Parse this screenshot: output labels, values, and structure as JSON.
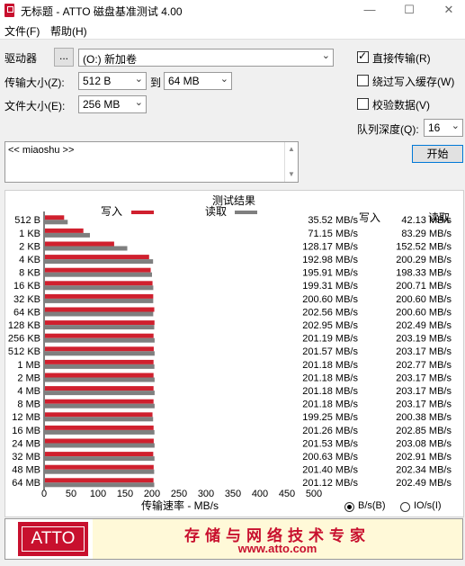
{
  "window": {
    "title": "无标题 - ATTO 磁盘基准测试 4.00",
    "minimize": "—",
    "maximize": "☐",
    "close": "✕"
  },
  "menu": {
    "file": "文件(F)",
    "help": "帮助(H)"
  },
  "settings": {
    "drive_label": "驱动器",
    "browse_label": "...",
    "drive_value": "(O:) 新加卷",
    "transfer_label": "传输大小(Z):",
    "transfer_from": "512 B",
    "to_label": "到",
    "transfer_to": "64 MB",
    "filesize_label": "文件大小(E):",
    "filesize_value": "256 MB",
    "direct_io_label": "直接传输(R)",
    "direct_io_checked": true,
    "bypass_cache_label": "绕过写入缓存(W)",
    "bypass_cache_checked": false,
    "verify_label": "校验数据(V)",
    "verify_checked": false,
    "queue_label": "队列深度(Q):",
    "queue_value": "16",
    "start_label": "开始"
  },
  "description": {
    "text": "<< miaoshu >>"
  },
  "results": {
    "title": "测试结果",
    "legend_write": "写入",
    "legend_read": "读取",
    "col_write": "写入",
    "col_read": "读取",
    "xlabel": "传输速率 - MB/s"
  },
  "units": {
    "bs_label": "B/s(B)",
    "ios_label": "IO/s(I)",
    "selected": "B/s"
  },
  "banner": {
    "logo_text": "ATTO",
    "slogan": "存储与网络技术专家",
    "url": "www.atto.com"
  },
  "colors": {
    "write": "#d0202e",
    "read": "#7f7f7f"
  },
  "chart_data": {
    "type": "bar",
    "title": "测试结果",
    "xlabel": "传输速率 - MB/s",
    "xlim": [
      0,
      500
    ],
    "xticks": [
      0,
      50,
      100,
      150,
      200,
      250,
      300,
      350,
      400,
      450,
      500
    ],
    "categories": [
      "512 B",
      "1 KB",
      "2 KB",
      "4 KB",
      "8 KB",
      "16 KB",
      "32 KB",
      "64 KB",
      "128 KB",
      "256 KB",
      "512 KB",
      "1 MB",
      "2 MB",
      "4 MB",
      "8 MB",
      "12 MB",
      "16 MB",
      "24 MB",
      "32 MB",
      "48 MB",
      "64 MB"
    ],
    "series": [
      {
        "name": "写入",
        "values": [
          35.52,
          71.15,
          128.17,
          192.98,
          195.91,
          199.31,
          200.6,
          202.56,
          202.95,
          201.19,
          201.57,
          201.18,
          201.18,
          201.18,
          201.18,
          199.25,
          201.26,
          201.53,
          200.63,
          201.4,
          201.12
        ],
        "labels": [
          "35.52 MB/s",
          "71.15 MB/s",
          "128.17 MB/s",
          "192.98 MB/s",
          "195.91 MB/s",
          "199.31 MB/s",
          "200.60 MB/s",
          "202.56 MB/s",
          "202.95 MB/s",
          "201.19 MB/s",
          "201.57 MB/s",
          "201.18 MB/s",
          "201.18 MB/s",
          "201.18 MB/s",
          "201.18 MB/s",
          "199.25 MB/s",
          "201.26 MB/s",
          "201.53 MB/s",
          "200.63 MB/s",
          "201.40 MB/s",
          "201.12 MB/s"
        ]
      },
      {
        "name": "读取",
        "values": [
          42.13,
          83.29,
          152.52,
          200.29,
          198.33,
          200.71,
          200.6,
          200.6,
          202.49,
          203.19,
          203.17,
          202.77,
          203.17,
          203.17,
          203.17,
          200.38,
          202.85,
          203.08,
          202.91,
          202.34,
          202.49
        ],
        "labels": [
          "42.13 MB/s",
          "83.29 MB/s",
          "152.52 MB/s",
          "200.29 MB/s",
          "198.33 MB/s",
          "200.71 MB/s",
          "200.60 MB/s",
          "200.60 MB/s",
          "202.49 MB/s",
          "203.19 MB/s",
          "203.17 MB/s",
          "202.77 MB/s",
          "203.17 MB/s",
          "203.17 MB/s",
          "203.17 MB/s",
          "200.38 MB/s",
          "202.85 MB/s",
          "203.08 MB/s",
          "202.91 MB/s",
          "202.34 MB/s",
          "202.49 MB/s"
        ]
      }
    ]
  }
}
